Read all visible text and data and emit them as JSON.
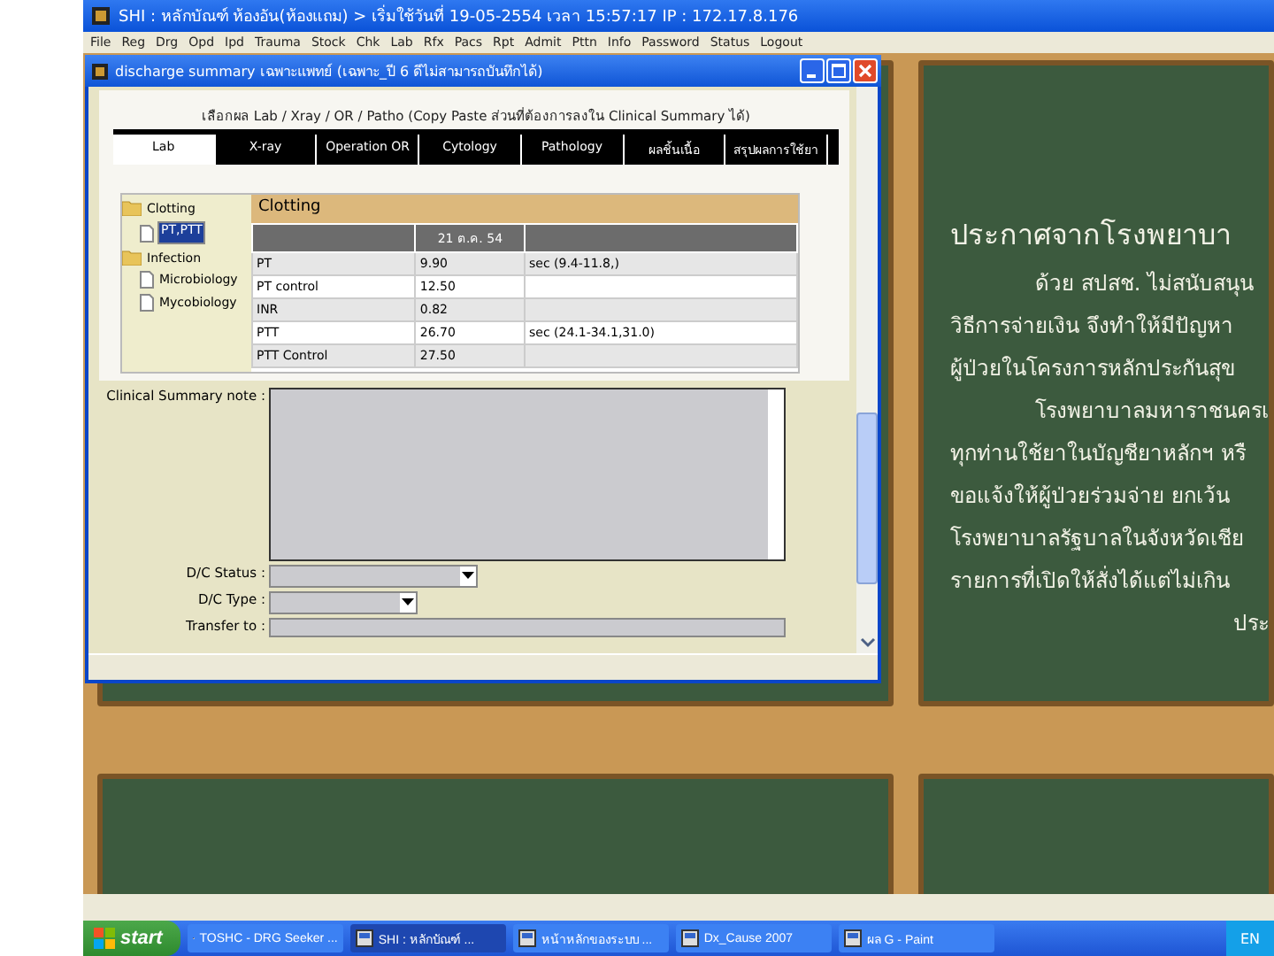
{
  "app_window": {
    "title": "SHI : หลักบัณฑ์ ห้องอัน(ห้องแถม) > เริ่มใช้วันที่ 19-05-2554 เวลา 15:57:17 IP : 172.17.8.176",
    "menu": [
      "File",
      "Reg",
      "Drg",
      "Opd",
      "Ipd",
      "Trauma",
      "Stock",
      "Chk",
      "Lab",
      "Rfx",
      "Pacs",
      "Rpt",
      "Admit",
      "Pttn",
      "Info",
      "Password",
      "Status",
      "Logout"
    ]
  },
  "dialog": {
    "title": "discharge summary เฉพาะแพทย์ (เฉพาะ_ปี 6 ดีไม่สามารถบันทึกได้)",
    "heading": "เลือกผล Lab / Xray / OR / Patho (Copy Paste ส่วนที่ต้องการลงใน Clinical Summary ได้)",
    "tabs": [
      {
        "label": "Lab",
        "selected": true
      },
      {
        "label": "X-ray",
        "selected": false
      },
      {
        "label": "Operation OR",
        "selected": false
      },
      {
        "label": "Cytology",
        "selected": false
      },
      {
        "label": "Pathology",
        "selected": false
      },
      {
        "label": "ผลชิ้นเนื้อ",
        "selected": false
      },
      {
        "label": "สรุปผลการใช้ยา",
        "selected": false
      }
    ],
    "tree": [
      {
        "label": "Clotting",
        "children": [
          {
            "label": "PT,PTT",
            "selected": true
          }
        ]
      },
      {
        "label": "Infection",
        "children": [
          {
            "label": "Microbiology",
            "selected": false
          },
          {
            "label": "Mycobiology",
            "selected": false
          }
        ]
      }
    ],
    "table": {
      "title": "Clotting",
      "date": "21 ต.ค. 54",
      "rows": [
        {
          "name": "PT",
          "value": "9.90",
          "reference": "sec (9.4-11.8,)"
        },
        {
          "name": "PT control",
          "value": "12.50"
        },
        {
          "name": "INR",
          "value": "0.82"
        },
        {
          "name": "PTT",
          "value": "26.70",
          "reference": "sec (24.1-34.1,31.0)"
        },
        {
          "name": "PTT Control",
          "value": "27.50"
        }
      ]
    },
    "fields": [
      {
        "kind": "textarea",
        "label": "Clinical Summary note :"
      },
      {
        "kind": "select",
        "label": "D/C Status :"
      },
      {
        "kind": "select-short",
        "label": "D/C Type :"
      },
      {
        "kind": "text",
        "label": "Transfer to :"
      }
    ]
  },
  "notice": {
    "lines": [
      {
        "kind": "title",
        "text": "ประกาศจากโรงพยาบา"
      },
      {
        "kind": "indent",
        "text": "ด้วย สปสช. ไม่สนับสนุน"
      },
      {
        "kind": "plain",
        "text": "วิธีการจ่ายเงิน จึงทำให้มีปัญหา"
      },
      {
        "kind": "plain",
        "text": "ผู้ป่วยในโครงการหลักประกันสุข"
      },
      {
        "kind": "indent",
        "text": "โรงพยาบาลมหาราชนครเ"
      },
      {
        "kind": "plain",
        "text": "ทุกท่านใช้ยาในบัญชียาหลักฯ หรื"
      },
      {
        "kind": "plain",
        "text": "ขอแจ้งให้ผู้ป่วยร่วมจ่าย ยกเว้น"
      },
      {
        "kind": "plain",
        "text": "โรงพยาบาลรัฐบาลในจังหวัดเชีย"
      },
      {
        "kind": "plain",
        "text": "รายการที่เปิดให้สั่งได้แต่ไม่เกิน"
      },
      {
        "kind": "sign",
        "text": "ประ"
      }
    ]
  },
  "taskbar": {
    "start": "start",
    "tasks": [
      {
        "label": "TOSHC - DRG Seeker ...",
        "selected": false
      },
      {
        "label": "SHI : หลักบัณฑ์ ...",
        "selected": true
      },
      {
        "label": "หน้าหลักของระบบ ...",
        "selected": false
      },
      {
        "label": "Dx_Cause 2007",
        "selected": false
      },
      {
        "label": "ผล G - Paint",
        "selected": false
      }
    ],
    "tray": "EN"
  }
}
